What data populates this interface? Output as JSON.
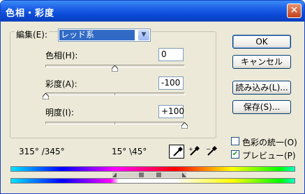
{
  "window": {
    "title": "色相・彩度",
    "close_glyph": "✕"
  },
  "edit": {
    "label": "編集(E):",
    "selected": "レッド系"
  },
  "sliders": [
    {
      "label": "色相(H):",
      "value": "0"
    },
    {
      "label": "彩度(A):",
      "value": "-100"
    },
    {
      "label": "明度(I):",
      "value": "+100"
    }
  ],
  "buttons": {
    "ok": "OK",
    "cancel": "キャンセル",
    "load": "読み込み(L)...",
    "save": "保存(S)..."
  },
  "options": {
    "colorize": "色彩の統一(O)",
    "colorize_checked": false,
    "preview": "プレビュー(P)",
    "preview_checked": true
  },
  "angles": {
    "range_outer": "315° /345°",
    "range_inner": "15° \\45°"
  },
  "eyedroppers": [
    "eyedropper-icon",
    "eyedropper-plus-icon",
    "eyedropper-minus-icon"
  ],
  "colors": {
    "title_bar": "#0a49d6",
    "selection": "#316ac5",
    "face": "#ece9d8"
  }
}
